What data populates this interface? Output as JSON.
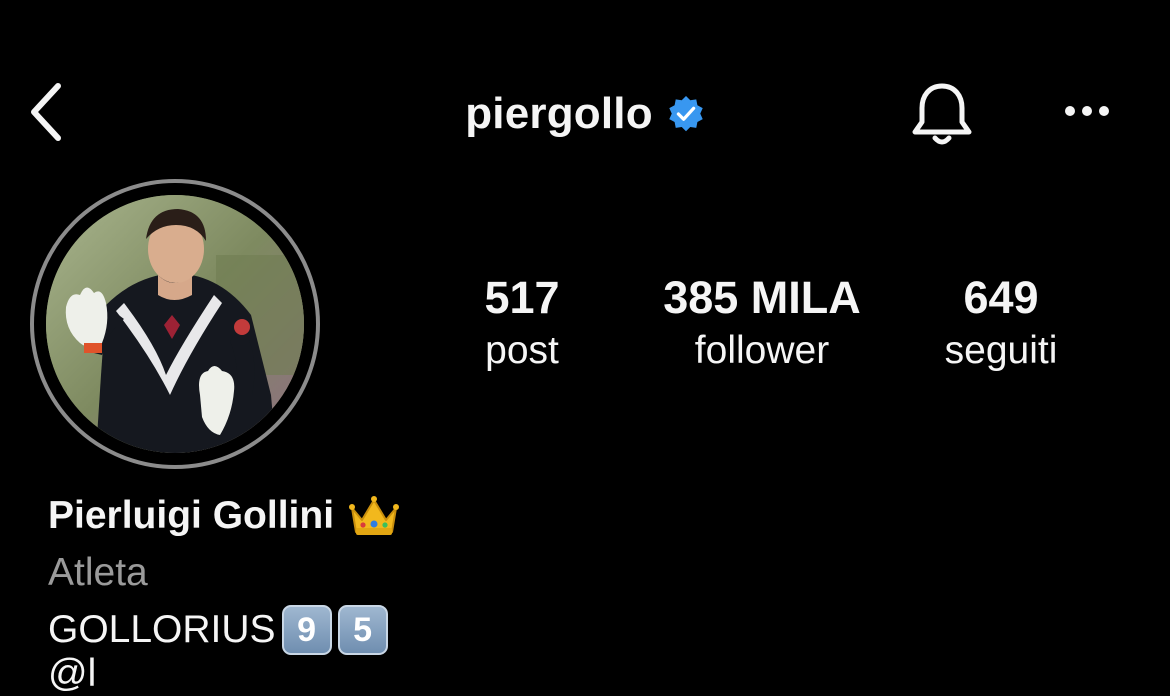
{
  "header": {
    "username": "piergollo",
    "icons": {
      "back": "chevron-left-icon",
      "verified": "verified-badge-icon",
      "notifications": "bell-icon",
      "more": "more-horizontal-icon"
    }
  },
  "stats": {
    "posts": {
      "value": "517",
      "label": "post"
    },
    "followers": {
      "value": "385 MILA",
      "label": "follower"
    },
    "following": {
      "value": "649",
      "label": "seguiti"
    }
  },
  "bio": {
    "full_name": "Pierluigi Gollini",
    "name_emoji": "crown-emoji",
    "category": "Atleta",
    "line1_text": "GOLLORIUS",
    "line1_keycaps": [
      "9",
      "5"
    ],
    "line2_text": "@l"
  },
  "colors": {
    "background": "#000000",
    "text": "#f5f5f5",
    "muted": "#9a9a9a",
    "verified_blue": "#3897f0",
    "avatar_ring": "#8c8c8c"
  }
}
